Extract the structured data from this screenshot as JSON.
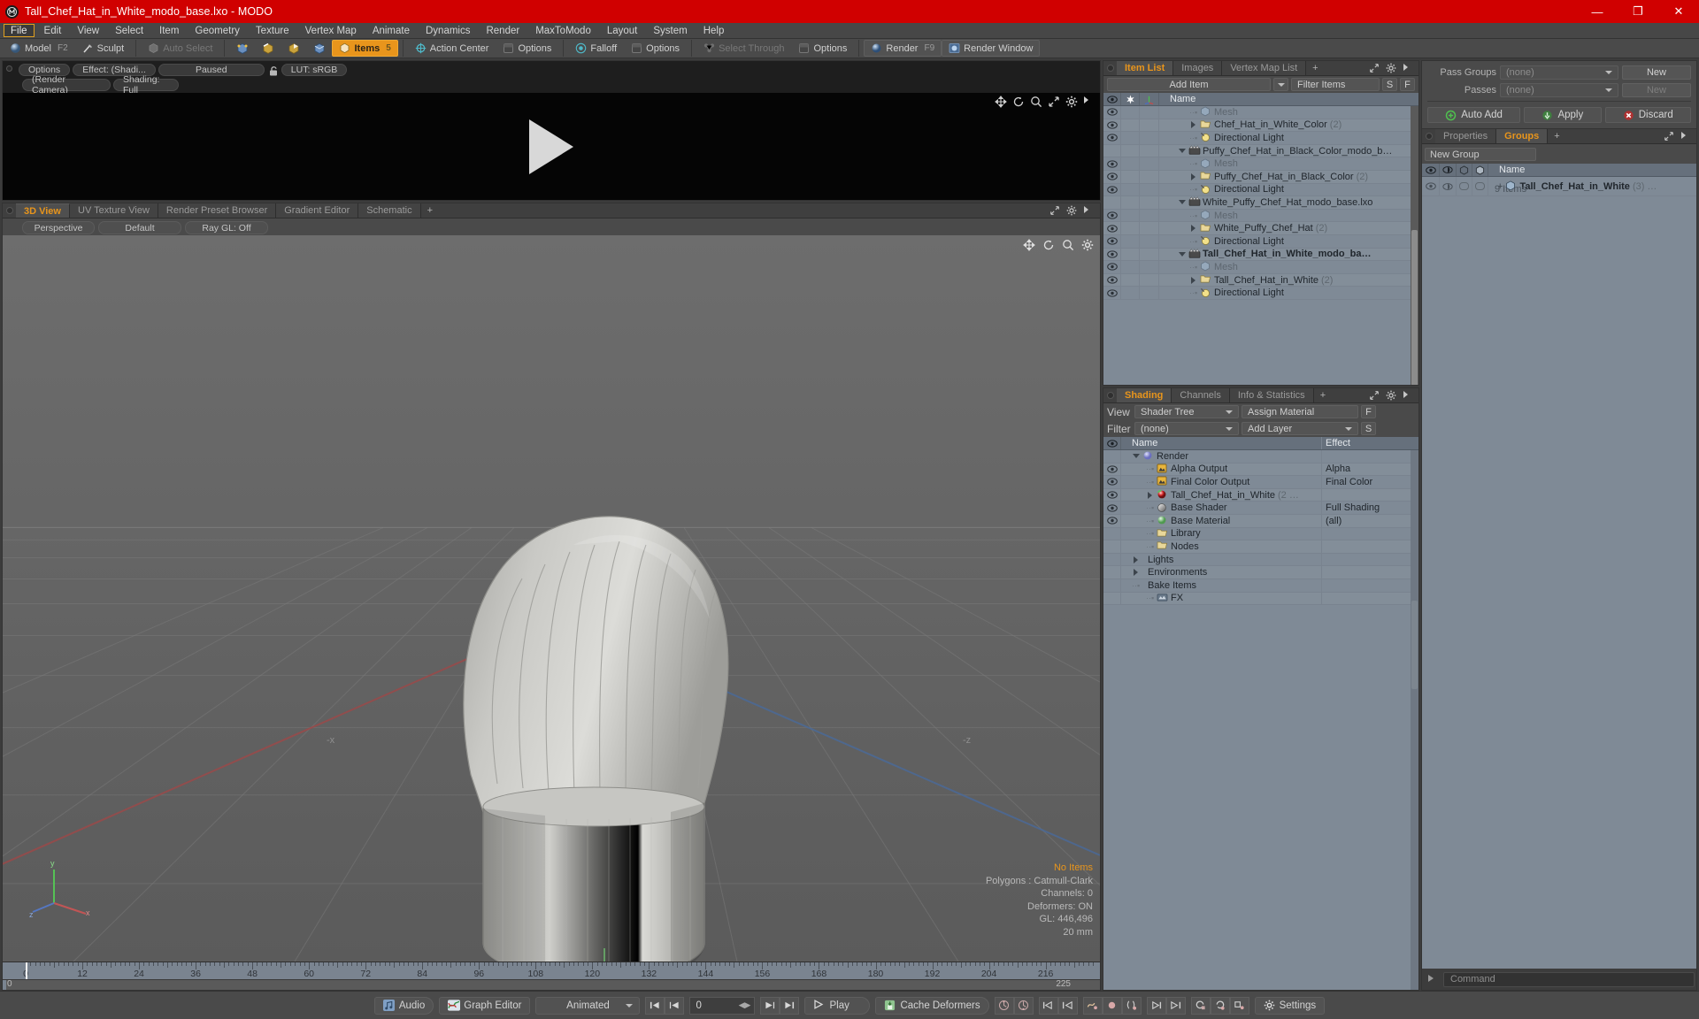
{
  "window": {
    "title": "Tall_Chef_Hat_in_White_modo_base.lxo - MODO",
    "app_icon": "modo-logo-icon",
    "minimize": "—",
    "maximize": "❐",
    "close": "✕",
    "accent_red": "#d00000",
    "accent_orange": "#e8951c"
  },
  "menu": {
    "items": [
      {
        "label": "File",
        "active": true
      },
      {
        "label": "Edit",
        "active": false
      },
      {
        "label": "View",
        "active": false
      },
      {
        "label": "Select",
        "active": false
      },
      {
        "label": "Item",
        "active": false
      },
      {
        "label": "Geometry",
        "active": false
      },
      {
        "label": "Texture",
        "active": false
      },
      {
        "label": "Vertex Map",
        "active": false
      },
      {
        "label": "Animate",
        "active": false
      },
      {
        "label": "Dynamics",
        "active": false
      },
      {
        "label": "Render",
        "active": false
      },
      {
        "label": "MaxToModo",
        "active": false
      },
      {
        "label": "Layout",
        "active": false
      },
      {
        "label": "System",
        "active": false
      },
      {
        "label": "Help",
        "active": false
      }
    ]
  },
  "toolbar": {
    "model": "Model",
    "model_shortcut": "F2",
    "sculpt": "Sculpt",
    "auto_select": "Auto Select",
    "items": "Items",
    "items_shortcut": "5",
    "action_center": "Action Center",
    "options_1": "Options",
    "falloff": "Falloff",
    "options_2": "Options",
    "select_through": "Select Through",
    "options_3": "Options",
    "render": "Render",
    "render_shortcut": "F9",
    "render_window": "Render Window"
  },
  "render_panel": {
    "options": "Options",
    "effect": "Effect: (Shadi...",
    "paused": "Paused",
    "lock_icon": "unlock-icon",
    "lut": "LUT: sRGB",
    "render_camera": "(Render Camera)",
    "shading": "Shading: Full",
    "play_icon": "play-triangle-icon"
  },
  "viewport": {
    "tabs": [
      {
        "label": "3D View",
        "active": true
      },
      {
        "label": "UV Texture View",
        "active": false
      },
      {
        "label": "Render Preset Browser",
        "active": false
      },
      {
        "label": "Gradient Editor",
        "active": false
      },
      {
        "label": "Schematic",
        "active": false
      }
    ],
    "add_tab": "+",
    "perspective": "Perspective",
    "default": "Default",
    "ray_gl": "Ray GL: Off",
    "axis_x": "-x",
    "axis_z": "-z",
    "stats": {
      "no_items": "No Items",
      "polygons": "Polygons : Catmull-Clark",
      "channels": "Channels: 0",
      "deformers": "Deformers: ON",
      "gl": "GL: 446,496",
      "grid": "20 mm"
    }
  },
  "timeline": {
    "ticks": [
      "0",
      "12",
      "24",
      "36",
      "48",
      "60",
      "72",
      "84",
      "96",
      "108",
      "120",
      "132",
      "144",
      "156",
      "168",
      "180",
      "192",
      "204",
      "216"
    ],
    "range_start": "0",
    "range_end": "225",
    "playhead_frame": "0"
  },
  "item_list": {
    "tabs": [
      {
        "label": "Item List",
        "active": true
      },
      {
        "label": "Images",
        "active": false
      },
      {
        "label": "Vertex Map List",
        "active": false
      }
    ],
    "add_tab": "+",
    "add_item": "Add Item",
    "filter_placeholder": "Filter Items",
    "btn_s": "S",
    "btn_f": "F",
    "col_eye": "eye-icon",
    "col_lock": "crosshair-icon",
    "col_axis": "axis-icon",
    "col_name": "Name",
    "rows": [
      {
        "label": "Mesh",
        "depth": 2,
        "type": "mesh",
        "twisty": "none",
        "count": "",
        "dim": true,
        "bold": false,
        "eye": true
      },
      {
        "label": "Chef_Hat_in_White_Color",
        "depth": 2,
        "type": "folder",
        "twisty": "right",
        "count": "(2)",
        "dim": false,
        "bold": false,
        "eye": true
      },
      {
        "label": "Directional Light",
        "depth": 2,
        "type": "light",
        "twisty": "none",
        "count": "",
        "dim": false,
        "bold": false,
        "eye": true
      },
      {
        "label": "Puffy_Chef_Hat_in_Black_Color_modo_b…",
        "depth": 1,
        "type": "scene",
        "twisty": "down",
        "count": "",
        "dim": false,
        "bold": false,
        "eye": false
      },
      {
        "label": "Mesh",
        "depth": 2,
        "type": "mesh",
        "twisty": "none",
        "count": "",
        "dim": true,
        "bold": false,
        "eye": true
      },
      {
        "label": "Puffy_Chef_Hat_in_Black_Color",
        "depth": 2,
        "type": "folder",
        "twisty": "right",
        "count": "(2)",
        "dim": false,
        "bold": false,
        "eye": true
      },
      {
        "label": "Directional Light",
        "depth": 2,
        "type": "light",
        "twisty": "none",
        "count": "",
        "dim": false,
        "bold": false,
        "eye": true
      },
      {
        "label": "White_Puffy_Chef_Hat_modo_base.lxo",
        "depth": 1,
        "type": "scene",
        "twisty": "down",
        "count": "",
        "dim": false,
        "bold": false,
        "eye": false
      },
      {
        "label": "Mesh",
        "depth": 2,
        "type": "mesh",
        "twisty": "none",
        "count": "",
        "dim": true,
        "bold": false,
        "eye": true
      },
      {
        "label": "White_Puffy_Chef_Hat",
        "depth": 2,
        "type": "folder",
        "twisty": "right",
        "count": "(2)",
        "dim": false,
        "bold": false,
        "eye": true
      },
      {
        "label": "Directional Light",
        "depth": 2,
        "type": "light",
        "twisty": "none",
        "count": "",
        "dim": false,
        "bold": false,
        "eye": true
      },
      {
        "label": "Tall_Chef_Hat_in_White_modo_ba…",
        "depth": 1,
        "type": "scene",
        "twisty": "down",
        "count": "",
        "dim": false,
        "bold": true,
        "eye": true
      },
      {
        "label": "Mesh",
        "depth": 2,
        "type": "mesh",
        "twisty": "none",
        "count": "",
        "dim": true,
        "bold": false,
        "eye": true
      },
      {
        "label": "Tall_Chef_Hat_in_White",
        "depth": 2,
        "type": "folder",
        "twisty": "right",
        "count": "(2)",
        "dim": false,
        "bold": false,
        "eye": true
      },
      {
        "label": "Directional Light",
        "depth": 2,
        "type": "light",
        "twisty": "none",
        "count": "",
        "dim": false,
        "bold": false,
        "eye": true
      }
    ]
  },
  "shading": {
    "tabs": [
      {
        "label": "Shading",
        "active": true
      },
      {
        "label": "Channels",
        "active": false
      },
      {
        "label": "Info & Statistics",
        "active": false
      }
    ],
    "add_tab": "+",
    "view_label": "View",
    "view_value": "Shader Tree",
    "assign_material": "Assign Material",
    "btn_f": "F",
    "filter_label": "Filter",
    "filter_value": "(none)",
    "add_layer": "Add Layer",
    "btn_s": "S",
    "col_name": "Name",
    "col_effect": "Effect",
    "rows": [
      {
        "label": "Render",
        "depth": 0,
        "type": "render",
        "twisty": "down",
        "effect": "",
        "count": "",
        "eye": false,
        "has_dd": false
      },
      {
        "label": "Alpha Output",
        "depth": 1,
        "type": "output",
        "twisty": "none",
        "effect": "Alpha",
        "count": "",
        "eye": true,
        "has_dd": true
      },
      {
        "label": "Final Color Output",
        "depth": 1,
        "type": "output",
        "twisty": "none",
        "effect": "Final Color",
        "count": "",
        "eye": true,
        "has_dd": true
      },
      {
        "label": "Tall_Chef_Hat_in_White",
        "depth": 1,
        "type": "material",
        "twisty": "right",
        "effect": "",
        "count": "(2 …",
        "eye": true,
        "has_dd": true
      },
      {
        "label": "Base Shader",
        "depth": 1,
        "type": "shader",
        "twisty": "none",
        "effect": "Full Shading",
        "count": "",
        "eye": true,
        "has_dd": true
      },
      {
        "label": "Base Material",
        "depth": 1,
        "type": "matball",
        "twisty": "none",
        "effect": "(all)",
        "count": "",
        "eye": true,
        "has_dd": true
      },
      {
        "label": "Library",
        "depth": 1,
        "type": "folder",
        "twisty": "none",
        "effect": "",
        "count": "",
        "eye": false,
        "has_dd": false
      },
      {
        "label": "Nodes",
        "depth": 1,
        "type": "folder",
        "twisty": "none",
        "effect": "",
        "count": "",
        "eye": false,
        "has_dd": false
      },
      {
        "label": "Lights",
        "depth": 0,
        "type": "plain",
        "twisty": "right",
        "effect": "",
        "count": "",
        "eye": false,
        "has_dd": false
      },
      {
        "label": "Environments",
        "depth": 0,
        "type": "plain",
        "twisty": "right",
        "effect": "",
        "count": "",
        "eye": false,
        "has_dd": false
      },
      {
        "label": "Bake Items",
        "depth": 0,
        "type": "plain",
        "twisty": "none",
        "effect": "",
        "count": "",
        "eye": false,
        "has_dd": false
      },
      {
        "label": "FX",
        "depth": 1,
        "type": "fx",
        "twisty": "none",
        "effect": "",
        "count": "",
        "eye": false,
        "has_dd": false
      }
    ]
  },
  "passes": {
    "pass_groups_label": "Pass Groups",
    "pass_groups_value": "(none)",
    "pass_groups_new": "New",
    "passes_label": "Passes",
    "passes_value": "(none)",
    "passes_new": "New",
    "auto_add": "Auto Add",
    "apply": "Apply",
    "discard": "Discard"
  },
  "groups": {
    "tabs": [
      {
        "label": "Properties",
        "active": false
      },
      {
        "label": "Groups",
        "active": true
      }
    ],
    "add_tab": "+",
    "new_group": "New Group",
    "col_name": "Name",
    "row_label": "Tall_Chef_Hat_in_White",
    "row_count": "(3)",
    "row_ellipsis": "…",
    "row_sub": "9 Items",
    "expand": "+"
  },
  "command": {
    "placeholder": "Command"
  },
  "bottom": {
    "audio": "Audio",
    "graph_editor": "Graph Editor",
    "animated": "Animated",
    "frame_value": "0",
    "play": "Play",
    "cache_deformers": "Cache Deformers",
    "settings": "Settings",
    "first_icon": "skip-to-start-icon",
    "prev_icon": "step-back-icon",
    "next_icon": "step-forward-icon",
    "last_icon": "skip-to-end-icon"
  }
}
